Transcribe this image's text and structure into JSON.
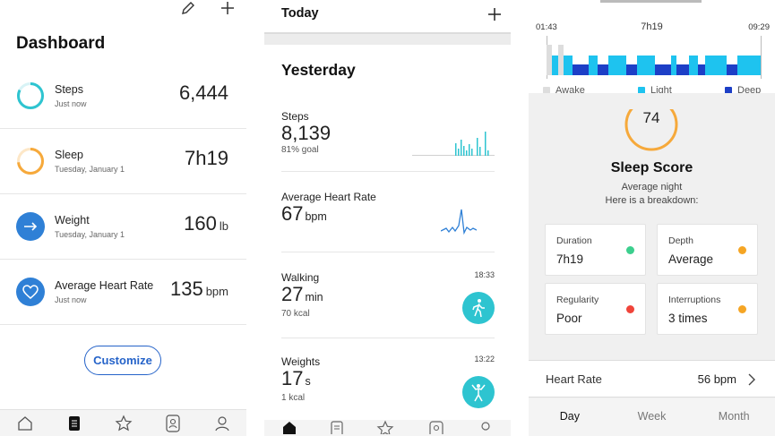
{
  "dashboard": {
    "title": "Dashboard",
    "metrics": [
      {
        "label": "Steps",
        "sub": "Just now",
        "value": "6,444",
        "unit": "",
        "icon": "steps-ring-icon",
        "color": "#2ec4d0"
      },
      {
        "label": "Sleep",
        "sub": "Tuesday, January 1",
        "value": "7h19",
        "unit": "",
        "icon": "sleep-ring-icon",
        "color": "#f6a93b"
      },
      {
        "label": "Weight",
        "sub": "Tuesday, January 1",
        "value": "160",
        "unit": "lb",
        "icon": "arrow-right-icon",
        "color": "#2f80d6"
      },
      {
        "label": "Average Heart Rate",
        "sub": "Just now",
        "value": "135",
        "unit": "bpm",
        "icon": "heart-icon",
        "color": "#2f80d6"
      }
    ],
    "customize_label": "Customize"
  },
  "timeline": {
    "today_label": "Today",
    "yesterday_label": "Yesterday",
    "entries": [
      {
        "label": "Steps",
        "value": "8,139",
        "unit": "",
        "sub": "81% goal",
        "time": ""
      },
      {
        "label": "Average Heart Rate",
        "value": "67",
        "unit": "bpm",
        "sub": "",
        "time": ""
      },
      {
        "label": "Walking",
        "value": "27",
        "unit": "min",
        "sub": "70 kcal",
        "time": "18:33"
      },
      {
        "label": "Weights",
        "value": "17",
        "unit": "s",
        "sub": "1 kcal",
        "time": "13:22"
      }
    ]
  },
  "sleep": {
    "start_time": "01:43",
    "duration": "7h19",
    "end_time": "09:29",
    "legend": [
      {
        "label": "Awake",
        "color": "#dddddd"
      },
      {
        "label": "Light",
        "color": "#1ec3ef"
      },
      {
        "label": "Deep",
        "color": "#1d3fc6"
      }
    ],
    "score": "74",
    "score_title": "Sleep Score",
    "score_sub1": "Average night",
    "score_sub2": "Here is a breakdown:",
    "tiles": [
      {
        "label": "Duration",
        "value": "7h19",
        "status_color": "#3ccf8e"
      },
      {
        "label": "Depth",
        "value": "Average",
        "status_color": "#f5a524"
      },
      {
        "label": "Regularity",
        "value": "Poor",
        "status_color": "#f0443a"
      },
      {
        "label": "Interruptions",
        "value": "3 times",
        "status_color": "#f5a524"
      }
    ],
    "heart_rate_label": "Heart Rate",
    "heart_rate_value": "56 bpm",
    "tabs": [
      "Day",
      "Week",
      "Month"
    ]
  }
}
